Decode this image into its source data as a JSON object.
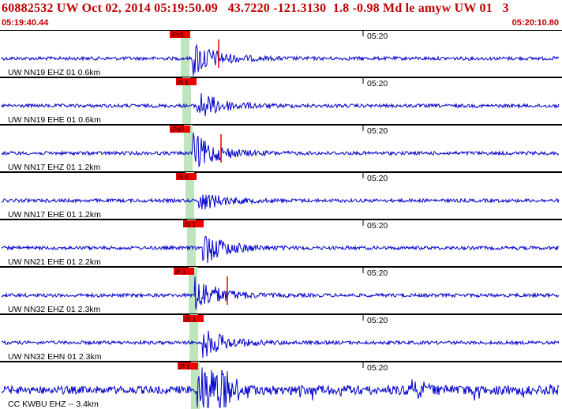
{
  "header": {
    "title": "60882532 UW Oct 02, 2014 05:19:50.09   43.7220 -121.3130  1.8 -0.98 Md le amyw UW 01   3",
    "start_time": "05:19:40.44",
    "end_time": "05:20:10.80"
  },
  "colors": {
    "header_text": "#c00000",
    "trace": "#0000cc",
    "pick_box": "#ee0000",
    "window_shade": "#bfe5bf",
    "divider": "#000000"
  },
  "traces": [
    {
      "label": "UW NN19 EHZ 01 0.6km",
      "pick": "iPc0",
      "time_mark": "05:20",
      "amp": 1.0
    },
    {
      "label": "UW NN19 EHE 01 0.6km",
      "pick": "iS 1",
      "time_mark": "05:20",
      "amp": 0.8
    },
    {
      "label": "UW NN17 EHZ 01 1.2km",
      "pick": "iPd0",
      "time_mark": "05:20",
      "amp": 1.05
    },
    {
      "label": "UW NN17 EHE 01 1.2km",
      "pick": "iS 0",
      "time_mark": "05:20",
      "amp": 0.55
    },
    {
      "label": "UW NN21 EHE 01 2.2km",
      "pick": "iS 1",
      "time_mark": "05:20",
      "amp": 0.9
    },
    {
      "label": "UW NN32 EHZ 01 2.3km",
      "pick": "iP 1",
      "time_mark": "05:20",
      "amp": 1.0
    },
    {
      "label": "UW NN32 EHN 01 2.3km",
      "pick": "iS 1",
      "time_mark": "05:20",
      "amp": 0.8
    },
    {
      "label": "CC KWBU EHZ -- 3.4km",
      "pick": "iP 1",
      "time_mark": "05:20",
      "amp": 1.1
    }
  ]
}
